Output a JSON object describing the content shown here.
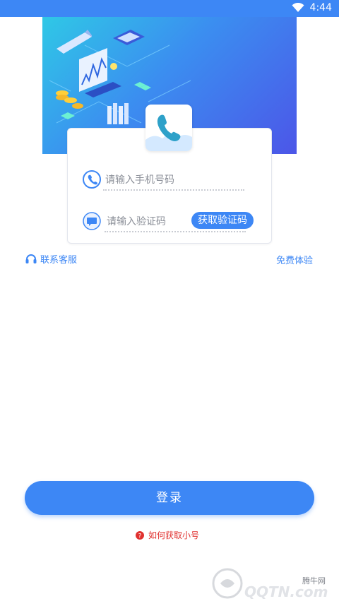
{
  "status_bar": {
    "time": "4:44",
    "wifi_icon": "wifi-icon"
  },
  "login": {
    "phone_placeholder": "请输入手机号码",
    "code_placeholder": "请输入验证码",
    "get_code_button": "获取验证码",
    "contact_service": "联系客服",
    "free_trial": "免费体验",
    "login_button": "登录",
    "help_text": "如何获取小号"
  },
  "watermark": {
    "site_text": "腾牛网",
    "logo_text": "QQTN.com"
  },
  "colors": {
    "primary": "#3d87f5",
    "danger": "#e0312f"
  }
}
